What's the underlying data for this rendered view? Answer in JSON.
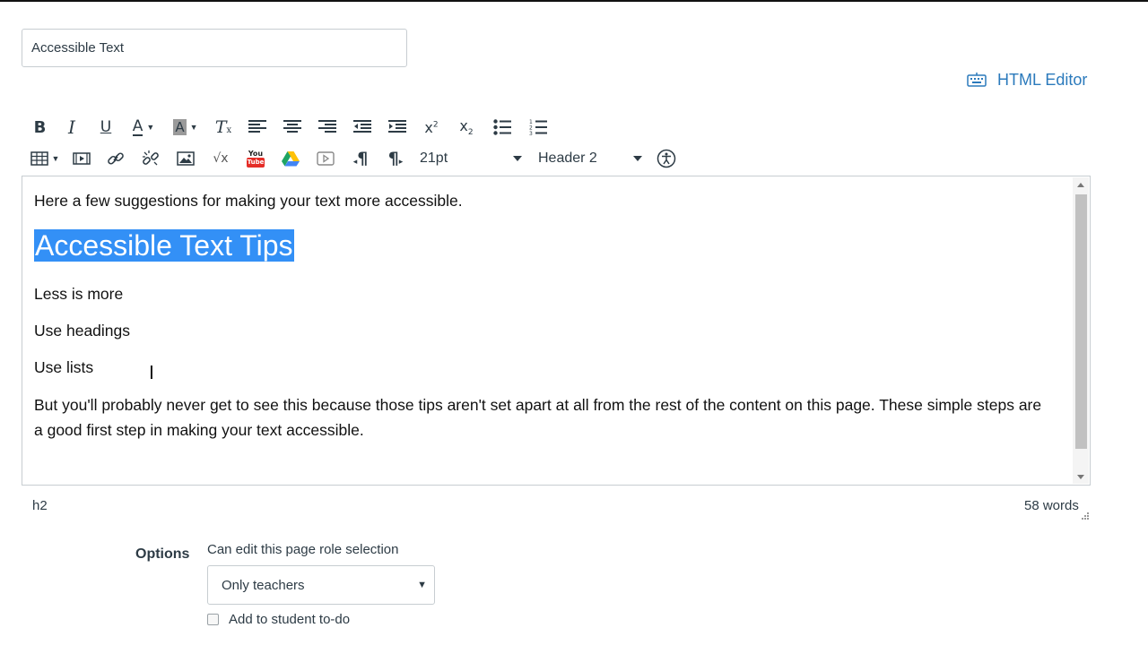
{
  "title_field": {
    "value": "Accessible Text"
  },
  "html_editor_link": {
    "label": "HTML Editor",
    "icon": "keyboard-icon"
  },
  "toolbar": {
    "row1": [
      {
        "name": "bold-button",
        "icon": "bold-icon"
      },
      {
        "name": "italic-button",
        "icon": "italic-icon"
      },
      {
        "name": "underline-button",
        "icon": "underline-icon"
      },
      {
        "name": "text-color-button",
        "icon": "text-color-icon",
        "dropdown": true
      },
      {
        "name": "background-color-button",
        "icon": "background-color-icon",
        "dropdown": true
      },
      {
        "name": "clear-formatting-button",
        "icon": "clear-formatting-icon"
      },
      {
        "name": "align-left-button",
        "icon": "align-left-icon"
      },
      {
        "name": "align-center-button",
        "icon": "align-center-icon"
      },
      {
        "name": "align-right-button",
        "icon": "align-right-icon"
      },
      {
        "name": "outdent-button",
        "icon": "outdent-icon"
      },
      {
        "name": "indent-button",
        "icon": "indent-icon"
      },
      {
        "name": "superscript-button",
        "icon": "superscript-icon"
      },
      {
        "name": "subscript-button",
        "icon": "subscript-icon"
      },
      {
        "name": "bullet-list-button",
        "icon": "bullet-list-icon"
      },
      {
        "name": "numbered-list-button",
        "icon": "numbered-list-icon"
      }
    ],
    "row2": [
      {
        "name": "table-button",
        "icon": "table-icon",
        "dropdown": true
      },
      {
        "name": "media-button",
        "icon": "media-icon"
      },
      {
        "name": "link-button",
        "icon": "link-icon"
      },
      {
        "name": "unlink-button",
        "icon": "unlink-icon"
      },
      {
        "name": "image-button",
        "icon": "image-icon"
      },
      {
        "name": "equation-button",
        "icon": "square-root-icon"
      },
      {
        "name": "youtube-button",
        "icon": "youtube-icon"
      },
      {
        "name": "google-drive-button",
        "icon": "google-drive-icon"
      },
      {
        "name": "embed-media-button",
        "icon": "play-icon"
      },
      {
        "name": "ltr-button",
        "icon": "paragraph-ltr-icon"
      },
      {
        "name": "rtl-button",
        "icon": "paragraph-rtl-icon"
      },
      {
        "name": "accessibility-checker-button",
        "icon": "accessibility-icon"
      }
    ],
    "font_size": "21pt",
    "block_format": "Header 2",
    "labels": {
      "bold": "B",
      "italic": "I",
      "underline": "U",
      "text_color": "A",
      "background_color": "A",
      "clear_formatting": "T",
      "superscript_base": "x",
      "superscript_exp": "2",
      "subscript_base": "x",
      "subscript_exp": "2",
      "sqrt": "√x",
      "youtube_top": "You",
      "youtube_bottom": "Tube",
      "ltr": "¶",
      "rtl": "¶"
    }
  },
  "editor": {
    "paragraph_intro": "Here a few suggestions for making your text more accessible.",
    "heading": "Accessible Text Tips",
    "tips": [
      "Less is more",
      "Use headings",
      "Use lists"
    ],
    "paragraph_outro": "But you'll probably never get to see this because those tips aren't set apart at all from the rest of the content on this page. These simple steps are a good first step in making your text accessible."
  },
  "status_bar": {
    "path": "h2",
    "word_count": "58 words"
  },
  "options": {
    "label": "Options",
    "role_label": "Can edit this page role selection",
    "role_value": "Only teachers",
    "todo_label": "Add to student to-do",
    "todo_checked": false
  },
  "colors": {
    "link": "#2b7abc",
    "selection": "#3390f6",
    "text": "#2d3b45",
    "border": "#c7cdd1"
  }
}
